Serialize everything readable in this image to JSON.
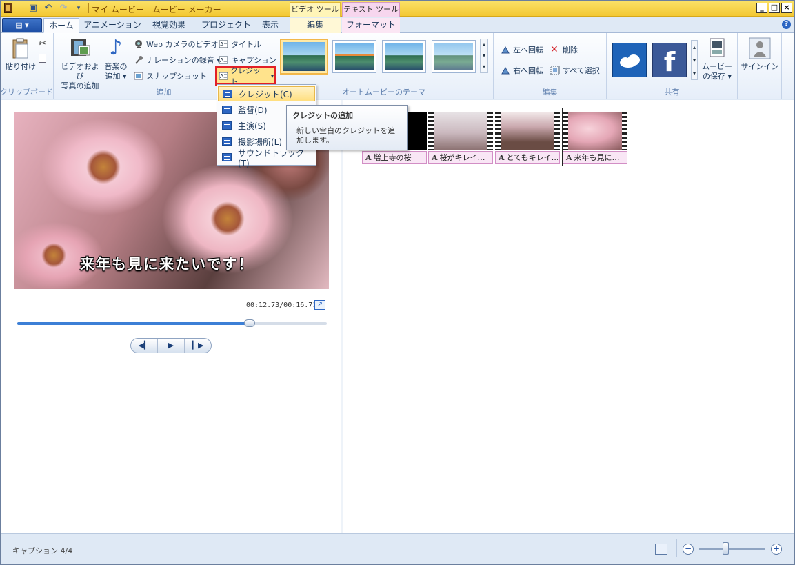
{
  "window": {
    "title": "マイ ムービー - ムービー メーカー",
    "context_video_tools": "ビデオ ツール",
    "context_text_tools": "テキスト ツール",
    "buttons": {
      "minimize": "_",
      "maximize": "□",
      "close": "×"
    }
  },
  "tabs": {
    "file": "▤ ▾",
    "items": [
      "ホーム",
      "アニメーション",
      "視覚効果",
      "プロジェクト",
      "表示",
      "編集",
      "フォーマット"
    ],
    "active_index": 0
  },
  "ribbon": {
    "clipboard": {
      "label": "クリップボード",
      "paste": "貼り付け"
    },
    "add": {
      "label": "追加",
      "add_videos_photos_line1": "ビデオおよび",
      "add_videos_photos_line2": "写真の追加",
      "add_music_line1": "音楽の",
      "add_music_line2": "追加 ▾",
      "webcam": "Web カメラのビデオ",
      "narration": "ナレーションの録音 ▾",
      "snapshot": "スナップショット",
      "title": "タイトル",
      "caption": "キャプション",
      "credits": "クレジット"
    },
    "themes": {
      "label": "オートムービーのテーマ"
    },
    "edit": {
      "label": "編集",
      "rotate_left": "左へ回転",
      "rotate_right": "右へ回転",
      "delete": "削除",
      "select_all": "すべて選択"
    },
    "share": {
      "label": "共有",
      "save_movie_line1": "ムービー",
      "save_movie_line2": "の保存 ▾",
      "sign_in": "サインイン"
    }
  },
  "credits_menu": {
    "items": [
      "クレジット(C)",
      "監督(D)",
      "主演(S)",
      "撮影場所(L)",
      "サウンドトラック(T)"
    ],
    "highlighted_index": 0
  },
  "tooltip": {
    "title": "クレジットの追加",
    "body": "新しい空白のクレジットを追加します。"
  },
  "preview": {
    "caption_overlay": "来年も見に来たいです！",
    "timecode": "00:12.73/00:16.71",
    "seek_fraction": 0.75,
    "controls": {
      "prev": "◀▎",
      "play": "▶",
      "next": "▎▶"
    }
  },
  "storyboard": {
    "captions": [
      "増上寺の桜",
      "桜がキレイ…",
      "とてもキレイ…",
      "来年も見に…"
    ]
  },
  "status": {
    "text": "キャプション 4/4",
    "zoom_fraction": 0.4
  }
}
